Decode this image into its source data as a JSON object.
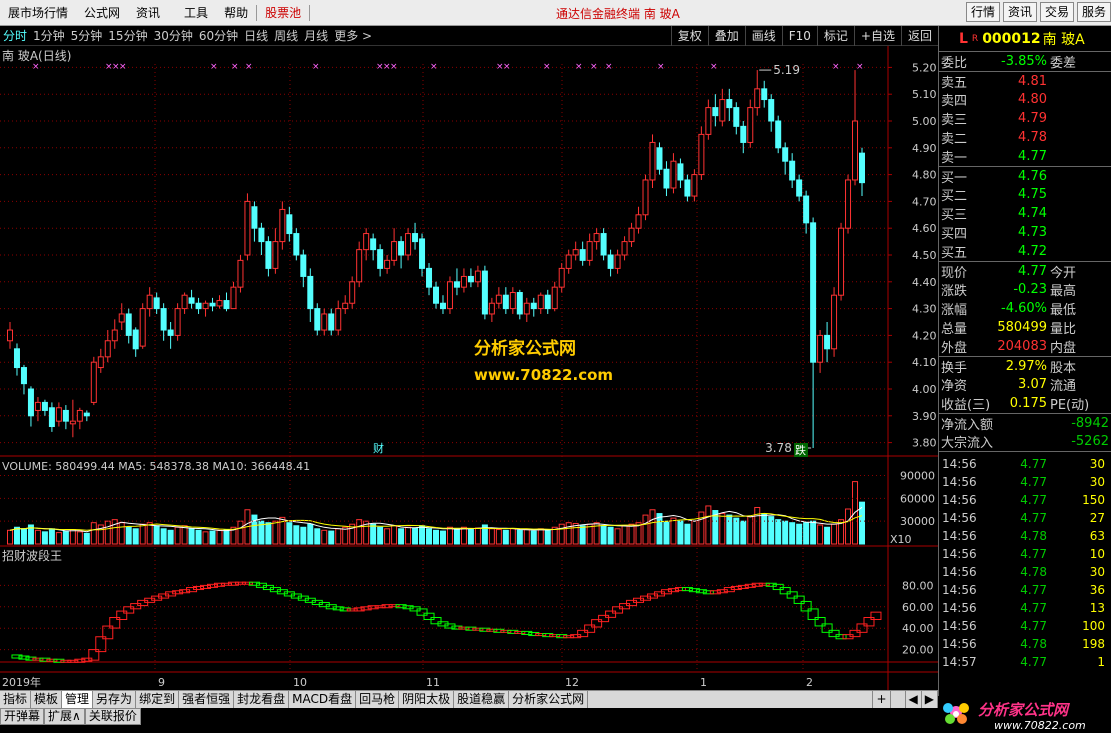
{
  "menubar": {
    "items": [
      "展市场行情",
      "公式网",
      "资讯",
      "工具",
      "帮助",
      "股票池"
    ],
    "center_title": "通达信金融终端   南 玻A",
    "right_buttons": [
      "行情",
      "资讯",
      "交易",
      "服务"
    ]
  },
  "periods": {
    "items": [
      "分时",
      "1分钟",
      "5分钟",
      "15分钟",
      "30分钟",
      "60分钟",
      "日线",
      "周线",
      "月线",
      "更多 >"
    ],
    "active": "日线",
    "tools": [
      "复权",
      "叠加",
      "画线",
      "F10",
      "标记",
      "+自选",
      "返回"
    ]
  },
  "chart": {
    "title": "南 玻A(日线)",
    "price_axis": [
      "5.20",
      "5.10",
      "5.00",
      "4.90",
      "4.80",
      "4.70",
      "4.60",
      "4.50",
      "4.40",
      "4.30",
      "4.20",
      "4.10",
      "4.00",
      "3.90",
      "3.80"
    ],
    "high_label": "5.19",
    "low_label": "3.78",
    "watermark_cn": "分析家公式网",
    "watermark_url": "www.70822.com",
    "marker_cai": "财",
    "marker_die": "跌",
    "volume_title": "VOLUME: 580499.44  MA5: 548378.38  MA10: 366448.41",
    "volume_axis": [
      "90000",
      "60000",
      "30000"
    ],
    "volume_unit": "X10",
    "indicator_title": "招财波段王",
    "indicator_axis": [
      "80.00",
      "60.00",
      "40.00",
      "20.00"
    ],
    "xaxis": [
      "2019年",
      "9",
      "10",
      "11",
      "12",
      "1",
      "2"
    ]
  },
  "colors": {
    "up": "#ff3232",
    "down": "#54ffff",
    "ma": "#ffffff",
    "grid": "#8b0000",
    "ind_up": "#ff2020",
    "ind_down": "#00ff00"
  },
  "chart_data": {
    "type": "candlestick",
    "ylim": [
      3.75,
      5.25
    ],
    "candles": [
      [
        4.18,
        4.22,
        4.25,
        4.15
      ],
      [
        4.15,
        4.08,
        4.17,
        4.05
      ],
      [
        4.08,
        4.02,
        4.09,
        3.98
      ],
      [
        4.0,
        3.9,
        4.01,
        3.86
      ],
      [
        3.92,
        3.95,
        3.97,
        3.88
      ],
      [
        3.95,
        3.92,
        3.96,
        3.9
      ],
      [
        3.93,
        3.86,
        3.95,
        3.84
      ],
      [
        3.88,
        3.93,
        3.95,
        3.86
      ],
      [
        3.92,
        3.88,
        3.94,
        3.85
      ],
      [
        3.87,
        3.88,
        3.96,
        3.82
      ],
      [
        3.88,
        3.92,
        3.93,
        3.85
      ],
      [
        3.91,
        3.9,
        3.92,
        3.88
      ],
      [
        3.95,
        4.1,
        4.12,
        3.94
      ],
      [
        4.08,
        4.12,
        4.15,
        4.06
      ],
      [
        4.12,
        4.18,
        4.22,
        4.1
      ],
      [
        4.18,
        4.22,
        4.26,
        4.15
      ],
      [
        4.25,
        4.28,
        4.32,
        4.22
      ],
      [
        4.28,
        4.2,
        4.3,
        4.17
      ],
      [
        4.22,
        4.15,
        4.23,
        4.12
      ],
      [
        4.16,
        4.3,
        4.32,
        4.15
      ],
      [
        4.3,
        4.35,
        4.38,
        4.27
      ],
      [
        4.34,
        4.3,
        4.36,
        4.28
      ],
      [
        4.3,
        4.22,
        4.32,
        4.18
      ],
      [
        4.22,
        4.2,
        4.25,
        4.15
      ],
      [
        4.2,
        4.3,
        4.32,
        4.18
      ],
      [
        4.3,
        4.35,
        4.36,
        4.28
      ],
      [
        4.34,
        4.32,
        4.37,
        4.3
      ],
      [
        4.32,
        4.3,
        4.34,
        4.28
      ],
      [
        4.3,
        4.32,
        4.33,
        4.27
      ],
      [
        4.32,
        4.31,
        4.34,
        4.29
      ],
      [
        4.31,
        4.33,
        4.35,
        4.3
      ],
      [
        4.33,
        4.3,
        4.36,
        4.29
      ],
      [
        4.3,
        4.38,
        4.4,
        4.3
      ],
      [
        4.38,
        4.48,
        4.5,
        4.36
      ],
      [
        4.5,
        4.7,
        4.73,
        4.48
      ],
      [
        4.68,
        4.6,
        4.7,
        4.55
      ],
      [
        4.6,
        4.55,
        4.62,
        4.5
      ],
      [
        4.55,
        4.45,
        4.57,
        4.42
      ],
      [
        4.45,
        4.55,
        4.6,
        4.43
      ],
      [
        4.55,
        4.67,
        4.7,
        4.52
      ],
      [
        4.65,
        4.58,
        4.68,
        4.55
      ],
      [
        4.58,
        4.5,
        4.6,
        4.48
      ],
      [
        4.5,
        4.42,
        4.52,
        4.38
      ],
      [
        4.42,
        4.3,
        4.45,
        4.25
      ],
      [
        4.3,
        4.22,
        4.32,
        4.2
      ],
      [
        4.22,
        4.28,
        4.3,
        4.2
      ],
      [
        4.28,
        4.22,
        4.3,
        4.2
      ],
      [
        4.22,
        4.3,
        4.33,
        4.2
      ],
      [
        4.3,
        4.32,
        4.35,
        4.28
      ],
      [
        4.32,
        4.4,
        4.42,
        4.3
      ],
      [
        4.4,
        4.52,
        4.55,
        4.38
      ],
      [
        4.52,
        4.58,
        4.6,
        4.48
      ],
      [
        4.56,
        4.52,
        4.58,
        4.48
      ],
      [
        4.52,
        4.45,
        4.54,
        4.42
      ],
      [
        4.45,
        4.48,
        4.5,
        4.43
      ],
      [
        4.48,
        4.55,
        4.6,
        4.46
      ],
      [
        4.55,
        4.5,
        4.57,
        4.45
      ],
      [
        4.5,
        4.58,
        4.6,
        4.48
      ],
      [
        4.58,
        4.55,
        4.62,
        4.52
      ],
      [
        4.56,
        4.45,
        4.58,
        4.42
      ],
      [
        4.45,
        4.38,
        4.47,
        4.35
      ],
      [
        4.38,
        4.32,
        4.4,
        4.3
      ],
      [
        4.32,
        4.3,
        4.35,
        4.28
      ],
      [
        4.3,
        4.4,
        4.42,
        4.28
      ],
      [
        4.4,
        4.38,
        4.45,
        4.35
      ],
      [
        4.38,
        4.42,
        4.45,
        4.36
      ],
      [
        4.42,
        4.4,
        4.45,
        4.38
      ],
      [
        4.4,
        4.44,
        4.46,
        4.38
      ],
      [
        4.44,
        4.28,
        4.46,
        4.26
      ],
      [
        4.28,
        4.32,
        4.34,
        4.25
      ],
      [
        4.32,
        4.35,
        4.38,
        4.3
      ],
      [
        4.35,
        4.3,
        4.38,
        4.28
      ],
      [
        4.3,
        4.36,
        4.38,
        4.28
      ],
      [
        4.36,
        4.28,
        4.37,
        4.26
      ],
      [
        4.28,
        4.32,
        4.34,
        4.25
      ],
      [
        4.32,
        4.3,
        4.34,
        4.27
      ],
      [
        4.3,
        4.35,
        4.36,
        4.28
      ],
      [
        4.35,
        4.3,
        4.37,
        4.28
      ],
      [
        4.3,
        4.38,
        4.4,
        4.29
      ],
      [
        4.38,
        4.45,
        4.47,
        4.36
      ],
      [
        4.45,
        4.5,
        4.52,
        4.43
      ],
      [
        4.5,
        4.52,
        4.55,
        4.48
      ],
      [
        4.52,
        4.48,
        4.55,
        4.46
      ],
      [
        4.48,
        4.55,
        4.58,
        4.46
      ],
      [
        4.55,
        4.58,
        4.6,
        4.52
      ],
      [
        4.58,
        4.5,
        4.6,
        4.48
      ],
      [
        4.5,
        4.45,
        4.52,
        4.42
      ],
      [
        4.45,
        4.5,
        4.52,
        4.43
      ],
      [
        4.5,
        4.55,
        4.57,
        4.48
      ],
      [
        4.55,
        4.6,
        4.62,
        4.53
      ],
      [
        4.6,
        4.65,
        4.68,
        4.58
      ],
      [
        4.65,
        4.78,
        4.8,
        4.63
      ],
      [
        4.78,
        4.92,
        4.95,
        4.75
      ],
      [
        4.9,
        4.82,
        4.92,
        4.8
      ],
      [
        4.82,
        4.75,
        4.85,
        4.72
      ],
      [
        4.75,
        4.85,
        4.88,
        4.73
      ],
      [
        4.84,
        4.78,
        4.86,
        4.75
      ],
      [
        4.78,
        4.72,
        4.8,
        4.7
      ],
      [
        4.72,
        4.8,
        4.82,
        4.7
      ],
      [
        4.8,
        4.95,
        4.98,
        4.78
      ],
      [
        4.95,
        5.05,
        5.08,
        4.93
      ],
      [
        5.05,
        5.02,
        5.1,
        4.98
      ],
      [
        5.0,
        5.08,
        5.12,
        4.98
      ],
      [
        5.08,
        5.05,
        5.12,
        5.0
      ],
      [
        5.05,
        4.98,
        5.07,
        4.95
      ],
      [
        4.98,
        4.92,
        5.0,
        4.88
      ],
      [
        4.92,
        5.05,
        5.08,
        4.9
      ],
      [
        5.05,
        5.12,
        5.19,
        5.02
      ],
      [
        5.12,
        5.08,
        5.15,
        5.05
      ],
      [
        5.08,
        5.0,
        5.1,
        4.96
      ],
      [
        5.0,
        4.9,
        5.02,
        4.88
      ],
      [
        4.9,
        4.85,
        4.92,
        4.8
      ],
      [
        4.85,
        4.78,
        4.88,
        4.75
      ],
      [
        4.78,
        4.72,
        4.8,
        4.7
      ],
      [
        4.72,
        4.62,
        4.74,
        4.58
      ],
      [
        4.62,
        4.1,
        4.64,
        3.78
      ],
      [
        4.1,
        4.2,
        4.22,
        4.06
      ],
      [
        4.2,
        4.15,
        4.25,
        4.1
      ],
      [
        4.15,
        4.35,
        4.38,
        4.12
      ],
      [
        4.35,
        4.6,
        4.62,
        4.33
      ],
      [
        4.6,
        4.78,
        4.8,
        4.58
      ],
      [
        4.78,
        5.0,
        5.19,
        4.76
      ],
      [
        4.88,
        4.77,
        4.9,
        4.72
      ]
    ],
    "volume": [
      18,
      22,
      20,
      25,
      18,
      16,
      20,
      15,
      17,
      19,
      16,
      14,
      28,
      25,
      30,
      32,
      28,
      22,
      20,
      26,
      28,
      24,
      20,
      18,
      22,
      24,
      20,
      18,
      16,
      17,
      18,
      19,
      22,
      30,
      45,
      38,
      30,
      28,
      30,
      35,
      28,
      24,
      22,
      26,
      20,
      18,
      17,
      20,
      22,
      26,
      32,
      30,
      26,
      22,
      20,
      24,
      20,
      22,
      21,
      24,
      20,
      18,
      17,
      22,
      20,
      22,
      19,
      21,
      25,
      20,
      19,
      18,
      20,
      18,
      19,
      17,
      20,
      18,
      22,
      26,
      28,
      27,
      24,
      26,
      28,
      24,
      22,
      20,
      24,
      26,
      28,
      38,
      45,
      40,
      30,
      34,
      30,
      26,
      30,
      42,
      50,
      44,
      40,
      38,
      34,
      30,
      36,
      48,
      40,
      36,
      32,
      30,
      28,
      26,
      28,
      30,
      25,
      22,
      26,
      32,
      46,
      82,
      55
    ],
    "indicator": [
      15,
      14,
      13,
      12,
      12,
      11,
      11,
      10,
      10,
      10,
      11,
      12,
      20,
      32,
      42,
      50,
      56,
      60,
      63,
      66,
      68,
      70,
      72,
      74,
      75,
      76,
      78,
      79,
      80,
      81,
      82,
      82,
      83,
      83,
      83,
      82,
      80,
      78,
      76,
      74,
      72,
      70,
      68,
      66,
      64,
      62,
      60,
      59,
      58,
      58,
      59,
      60,
      61,
      61,
      62,
      62,
      61,
      60,
      58,
      54,
      50,
      46,
      44,
      42,
      41,
      41,
      40,
      40,
      39,
      39,
      38,
      38,
      37,
      37,
      36,
      35,
      35,
      34,
      34,
      33,
      33,
      34,
      38,
      43,
      48,
      52,
      56,
      60,
      63,
      66,
      68,
      70,
      72,
      74,
      76,
      77,
      78,
      77,
      76,
      75,
      74,
      75,
      76,
      78,
      79,
      80,
      81,
      82,
      82,
      81,
      78,
      74,
      70,
      65,
      58,
      50,
      44,
      38,
      34,
      32,
      34,
      38,
      44,
      50,
      55
    ]
  },
  "quote": {
    "code_prefix": "L",
    "code_sup": "R",
    "code": "000012",
    "name": "南 玻A",
    "rows": [
      {
        "label": "委比",
        "value": "-3.85%",
        "extra": "委差",
        "color": "#00ff00"
      },
      {
        "label": "卖五",
        "value": "4.81",
        "extra": "",
        "color": "#ff3232"
      },
      {
        "label": "卖四",
        "value": "4.80",
        "extra": "",
        "color": "#ff3232"
      },
      {
        "label": "卖三",
        "value": "4.79",
        "extra": "",
        "color": "#ff3232"
      },
      {
        "label": "卖二",
        "value": "4.78",
        "extra": "",
        "color": "#ff3232"
      },
      {
        "label": "卖一",
        "value": "4.77",
        "extra": "",
        "color": "#00ff00"
      },
      {
        "label": "买一",
        "value": "4.76",
        "extra": "",
        "color": "#00ff00"
      },
      {
        "label": "买二",
        "value": "4.75",
        "extra": "",
        "color": "#00ff00"
      },
      {
        "label": "买三",
        "value": "4.74",
        "extra": "",
        "color": "#00ff00"
      },
      {
        "label": "买四",
        "value": "4.73",
        "extra": "",
        "color": "#00ff00"
      },
      {
        "label": "买五",
        "value": "4.72",
        "extra": "",
        "color": "#00ff00"
      },
      {
        "label": "现价",
        "value": "4.77",
        "extra": "今开",
        "color": "#00ff00"
      },
      {
        "label": "涨跌",
        "value": "-0.23",
        "extra": "最高",
        "color": "#00ff00"
      },
      {
        "label": "涨幅",
        "value": "-4.60%",
        "extra": "最低",
        "color": "#00ff00"
      },
      {
        "label": "总量",
        "value": "580499",
        "extra": "量比",
        "color": "#ffff00"
      },
      {
        "label": "外盘",
        "value": "204083",
        "extra": "内盘",
        "color": "#ff3232"
      },
      {
        "label": "换手",
        "value": "2.97%",
        "extra": "股本",
        "color": "#ffff00"
      },
      {
        "label": "净资",
        "value": "3.07",
        "extra": "流通",
        "color": "#ffff00"
      },
      {
        "label": "收益(三)",
        "value": "0.175",
        "extra": "PE(动)",
        "color": "#ffff00"
      }
    ],
    "netflow_label": "净流入额",
    "netflow_value": "-8942",
    "bigflow_label": "大宗流入",
    "bigflow_value": "-5262"
  },
  "ticks": [
    {
      "t": "14:56",
      "p": "4.77",
      "v": "30"
    },
    {
      "t": "14:56",
      "p": "4.77",
      "v": "30"
    },
    {
      "t": "14:56",
      "p": "4.77",
      "v": "150"
    },
    {
      "t": "14:56",
      "p": "4.77",
      "v": "27"
    },
    {
      "t": "14:56",
      "p": "4.78",
      "v": "63"
    },
    {
      "t": "14:56",
      "p": "4.77",
      "v": "10"
    },
    {
      "t": "14:56",
      "p": "4.78",
      "v": "30"
    },
    {
      "t": "14:56",
      "p": "4.77",
      "v": "36"
    },
    {
      "t": "14:56",
      "p": "4.77",
      "v": "13"
    },
    {
      "t": "14:56",
      "p": "4.77",
      "v": "100"
    },
    {
      "t": "14:56",
      "p": "4.78",
      "v": "198"
    },
    {
      "t": "14:57",
      "p": "4.77",
      "v": "1"
    }
  ],
  "tabs": {
    "items": [
      "指标",
      "模板",
      "管理",
      "另存为",
      "绑定到",
      "强者恒强",
      "封龙看盘",
      "MACD看盘",
      "回马枪",
      "阴阳太极",
      "股道稳赢",
      "分析家公式网"
    ],
    "active": "管理",
    "plus": "+",
    "left": "◀",
    "right": "▶"
  },
  "status": {
    "items": [
      "开弹幕",
      "扩展∧",
      "关联报价"
    ]
  },
  "logo": {
    "text": "分析家公式网",
    "url": "www.70822.com"
  }
}
